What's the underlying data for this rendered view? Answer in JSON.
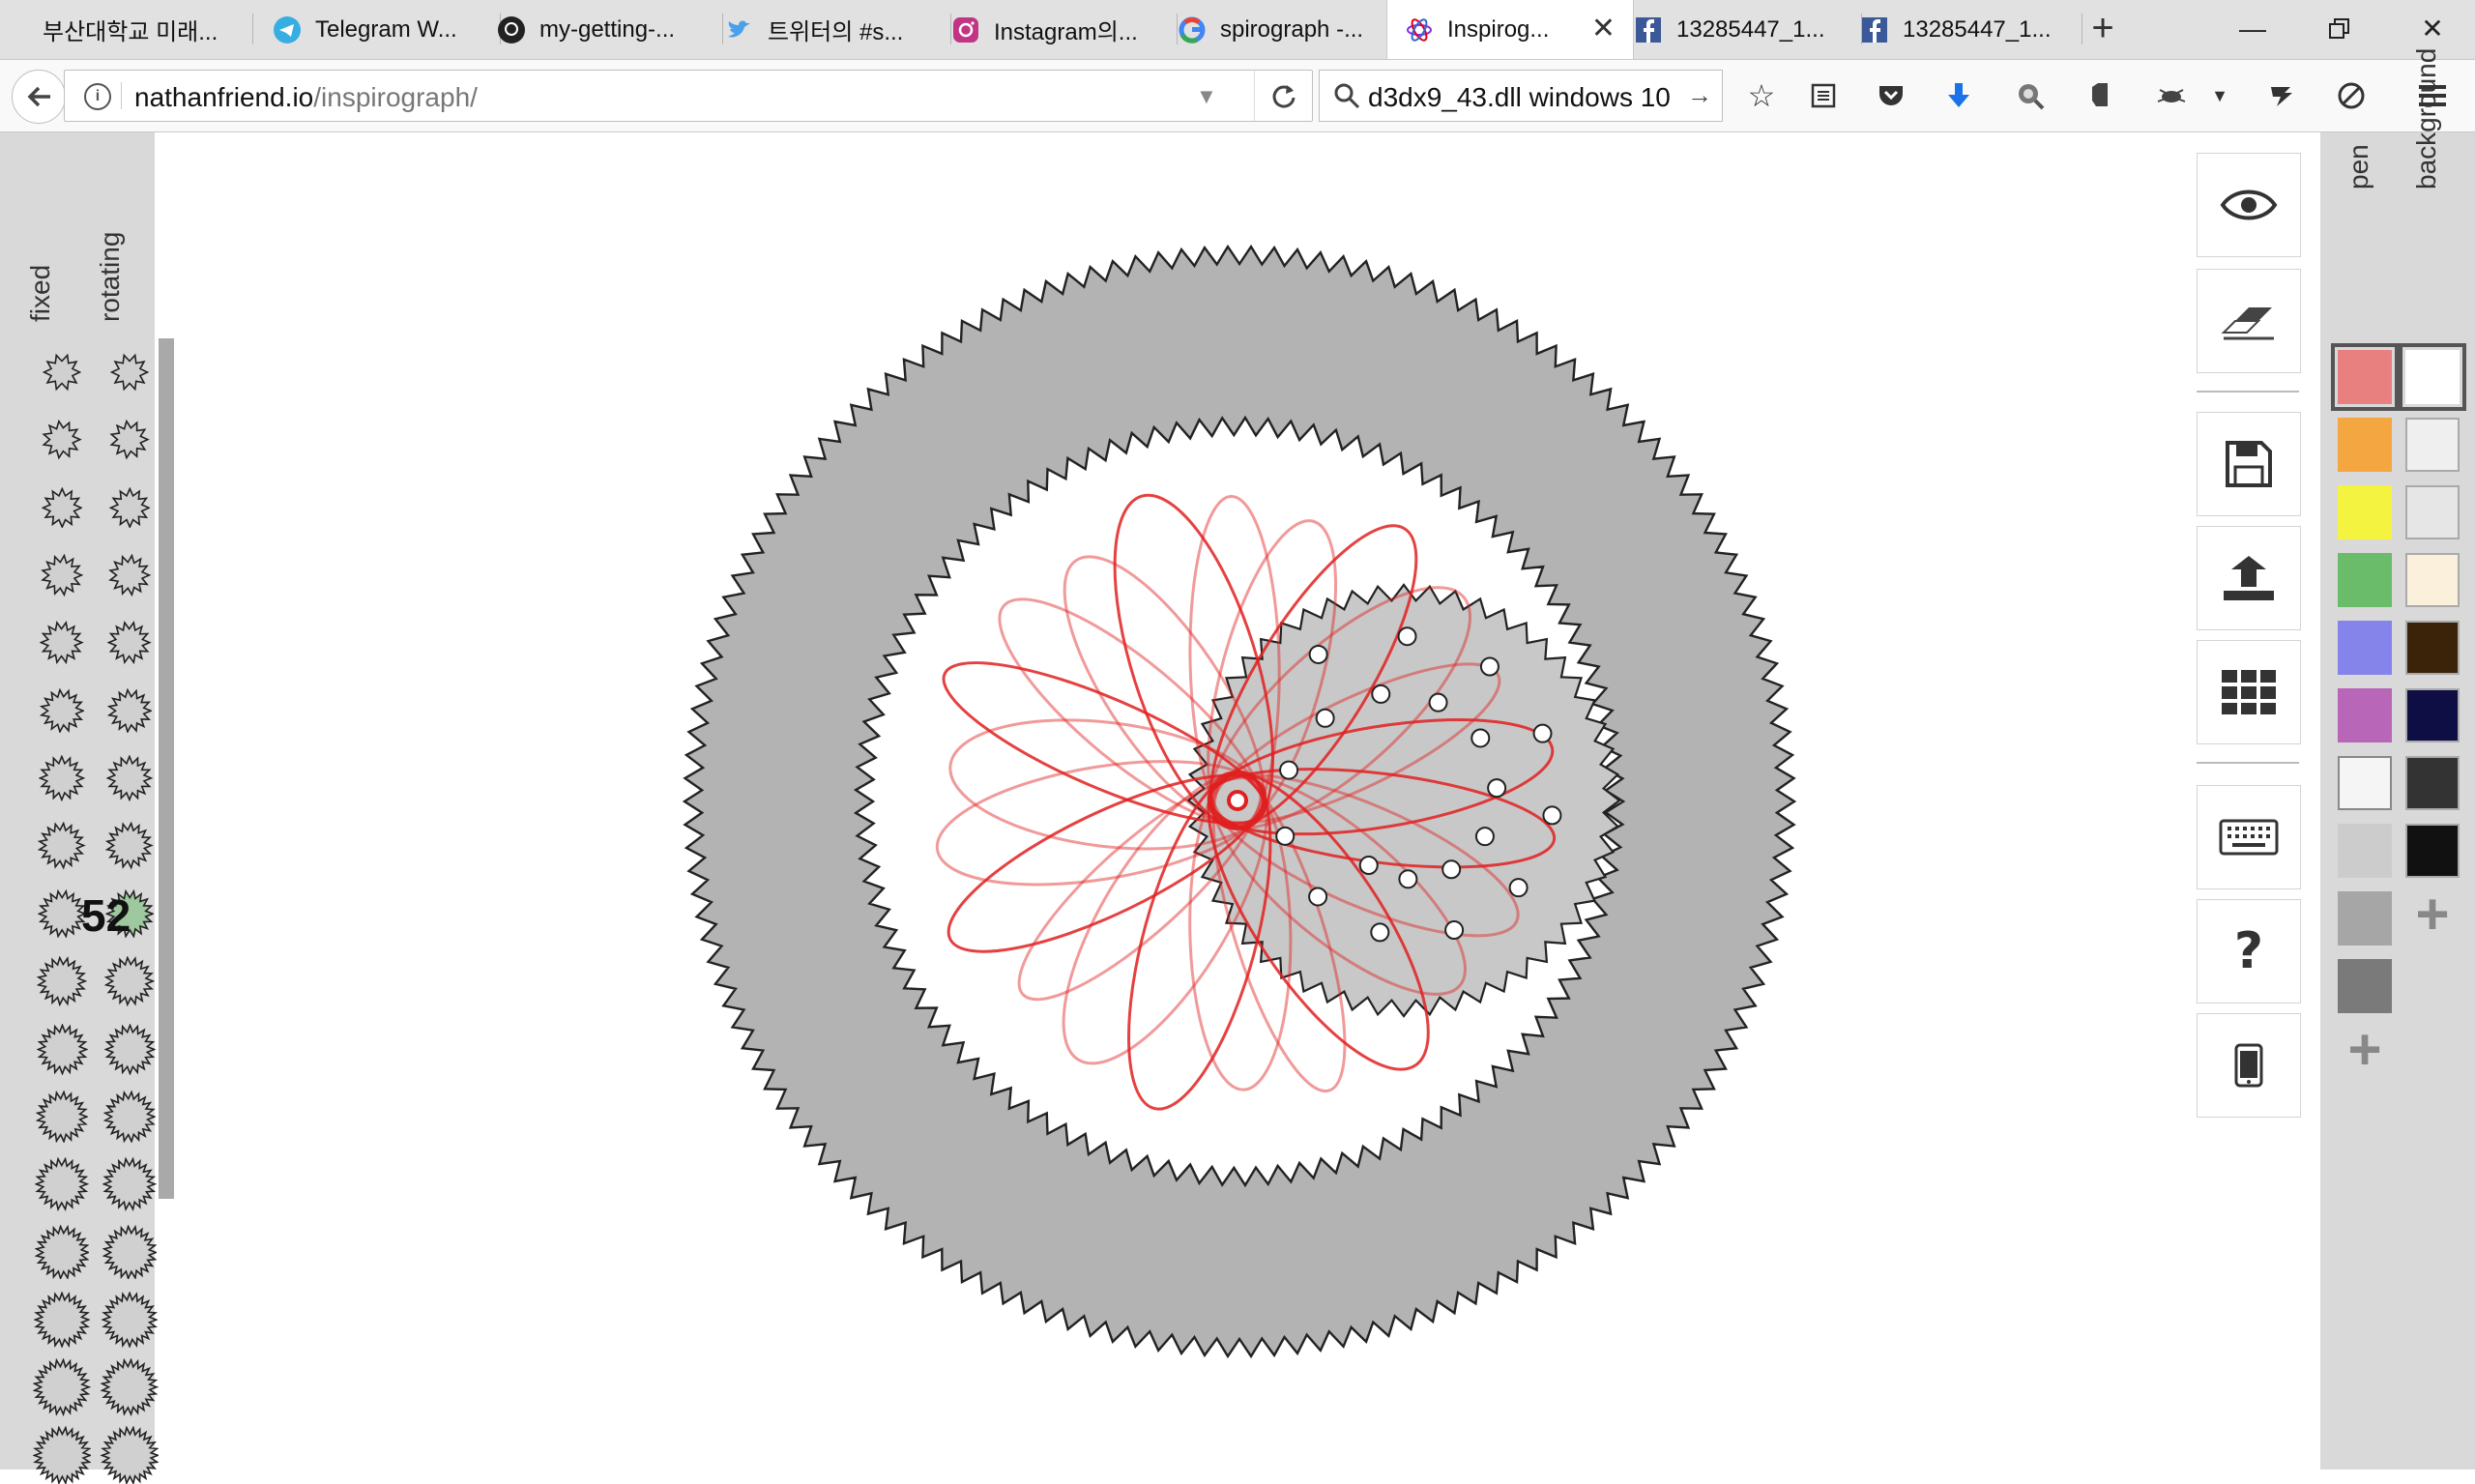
{
  "tabs": [
    {
      "label": "부산대학교 미래...",
      "icon": "flag-icon"
    },
    {
      "label": "Telegram W...",
      "icon": "telegram-icon"
    },
    {
      "label": "my-getting-...",
      "icon": "github-icon"
    },
    {
      "label": "트위터의 #s...",
      "icon": "twitter-icon"
    },
    {
      "label": "Instagram의...",
      "icon": "instagram-icon"
    },
    {
      "label": "spirograph -...",
      "icon": "google-icon"
    },
    {
      "label": "Inspirog...",
      "icon": "inspirograph-icon",
      "active": true
    },
    {
      "label": "13285447_1...",
      "icon": "facebook-icon"
    },
    {
      "label": "13285447_1...",
      "icon": "facebook-icon"
    }
  ],
  "nav": {
    "url_host": "nathanfriend.io",
    "url_path": "/inspirograph/",
    "search_value": "d3dx9_43.dll windows 10"
  },
  "left_panel": {
    "fixed_label": "fixed",
    "rotating_label": "rotating",
    "selected_rotating_teeth": "52"
  },
  "color_panel": {
    "pen_label": "pen",
    "background_label": "background",
    "pen_colors": [
      "#e88080",
      "#f4a640",
      "#f4f440",
      "#6abb6a",
      "#8484ea",
      "#b866b8",
      "#f5f5f5",
      "#cccccc",
      "#a6a6a6",
      "#7a7a7a"
    ],
    "background_colors": [
      "#ffffff",
      "#efefef",
      "#e6e6e6",
      "#faf0dc",
      "#3a2308",
      "#0e0e44",
      "#333333",
      "#111111"
    ],
    "selected_pen": "#e88080",
    "selected_background": "#ffffff"
  },
  "toolbar_right": [
    "eye-icon",
    "eraser-icon",
    "save-icon",
    "upload-icon",
    "grid-icon",
    "keyboard-icon",
    "help-icon",
    "mobile-icon"
  ],
  "spirograph": {
    "pen_color": "#e02020",
    "fixed_gear_fill": "#b3b3b3",
    "rotating_gear_fill": "#c8c8c8"
  }
}
